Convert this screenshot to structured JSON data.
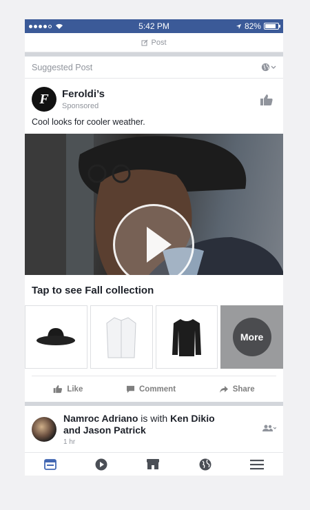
{
  "status_bar": {
    "time": "5:42 PM",
    "battery": "82%",
    "battery_fill": 0.82
  },
  "top_bar": {
    "post_label": "Post"
  },
  "suggested": {
    "label": "Suggested Post"
  },
  "ad": {
    "author": "Feroldi’s",
    "logo_letter": "F",
    "sponsored": "Sponsored",
    "caption": "Cool looks for cooler weather.",
    "collection_title": "Tap to see Fall collection",
    "products": [
      {
        "name": "hat-image"
      },
      {
        "name": "shirt-image"
      },
      {
        "name": "sweater-image"
      }
    ],
    "more_label": "More"
  },
  "actions": {
    "like": "Like",
    "comment": "Comment",
    "share": "Share"
  },
  "story": {
    "author": "Namroc Adriano",
    "with_text": " is with ",
    "tagged1": "Ken Dikio",
    "and_text": "and ",
    "tagged2": "Jason Patrick",
    "time": "1 hr"
  },
  "colors": {
    "brand": "#3b5a98",
    "text_secondary": "#90949c"
  },
  "tabs": [
    "news-feed-icon",
    "video-icon",
    "marketplace-icon",
    "globe-icon",
    "menu-icon"
  ]
}
